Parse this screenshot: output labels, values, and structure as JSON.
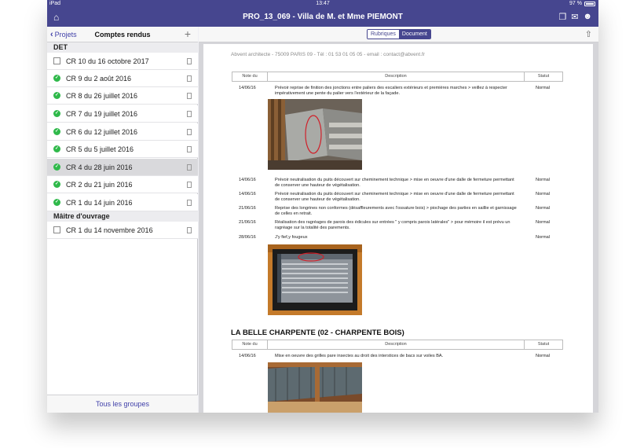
{
  "status": {
    "device": "iPad",
    "time": "13:47",
    "battery": "97 %"
  },
  "nav": {
    "title": "PRO_13_069 - Villa de M. et Mme PIEMONT"
  },
  "sidebar": {
    "back_label": "Projets",
    "title": "Comptes rendus",
    "add_label": "+",
    "section_det": "DET",
    "items": [
      {
        "label": "CR 10 du 16 octobre 2017"
      },
      {
        "label": "CR 9 du 2 août 2016"
      },
      {
        "label": "CR 8 du 26 juillet 2016"
      },
      {
        "label": "CR 7 du 19 juillet 2016"
      },
      {
        "label": "CR 6 du 12 juillet 2016"
      },
      {
        "label": "CR 5 du 5 juillet 2016"
      },
      {
        "label": "CR 4 du 28 juin 2016"
      },
      {
        "label": "CR 2 du 21 juin 2016"
      },
      {
        "label": "CR 1 du 14 juin 2016"
      }
    ],
    "section_mo": "Mâitre d'ouvrage",
    "mo_items": [
      {
        "label": "CR 1 du 14 novembre 2016"
      }
    ],
    "footer": "Tous les groupes"
  },
  "doc": {
    "seg_rubriques": "Rubriques",
    "seg_document": "Document",
    "address": "Abvent architecte  - 75009 PARIS 09 - Tél : 01 53 01 05 05 - email : contact@abvent.fr",
    "headers": {
      "note": "Note du",
      "description": "Description",
      "statut": "Statut"
    },
    "rows1": [
      {
        "date": "14/06/16",
        "text": "Prévoir reprise de finition des jonctions entre paliers des escaliers extérieurs et premières marches > veillez à respecter impérativement une pente du palier vers l'extérieur de la façade.",
        "status": "Normal"
      },
      {
        "date": "14/06/16",
        "text": "Prévoir neutralisation du puits découvert sur cheminement technique > mise en oeuvre d'une dalle de fermeture permettant de conserver une hauteur de végétalisation.",
        "status": "Normal"
      },
      {
        "date": "14/06/16",
        "text": "Prévoir neutralisation du puits découvert sur cheminement technique > mise en oeuvre d'une dalle de fermeture permettant de conserver une hauteur de végétalisation.",
        "status": "Normal"
      },
      {
        "date": "21/06/16",
        "text": "Reprise des longrines non conformes (désaffleurements avec l'ossature bois) > piochage des parties en saillie et garnissage de celles en retrait.",
        "status": "Normal"
      },
      {
        "date": "21/06/16",
        "text": "Réalisation des ragréages de parois des édicules sur entrées \" y compris parois latérales\" > pour mémoire il est prévu un ragréage sur la totalité des parements.",
        "status": "Normal"
      },
      {
        "date": "28/06/16",
        "text": "J'y fief,y fougeux",
        "status": "Normal"
      }
    ],
    "section2_title": "LA BELLE CHARPENTE (02 - CHARPENTE BOIS)",
    "rows2": [
      {
        "date": "14/06/16",
        "text": "Mise en oeuvre des grilles pare insectes au droit des interstices de bacs sur voiles BA.",
        "status": "Normal"
      }
    ]
  }
}
